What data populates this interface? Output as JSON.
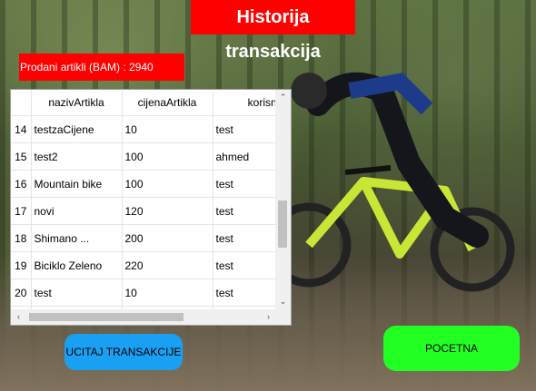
{
  "window": {
    "title": "Historija transakcija"
  },
  "summary": {
    "sold_label": "Prodani artikli (BAM) : 2940"
  },
  "table": {
    "columns": [
      "nazivArtikla",
      "cijenaArtikla",
      "korisnik"
    ],
    "rows": [
      {
        "num": "14",
        "naziv": "testzaCijene",
        "cijena": "10",
        "korisnik": "test"
      },
      {
        "num": "15",
        "naziv": "test2",
        "cijena": "100",
        "korisnik": "ahmed"
      },
      {
        "num": "16",
        "naziv": "Mountain bike",
        "cijena": "100",
        "korisnik": "test"
      },
      {
        "num": "17",
        "naziv": "novi",
        "cijena": "120",
        "korisnik": "test"
      },
      {
        "num": "18",
        "naziv": "Shimano ...",
        "cijena": "200",
        "korisnik": "test"
      },
      {
        "num": "19",
        "naziv": "Biciklo Zeleno",
        "cijena": "220",
        "korisnik": "test"
      },
      {
        "num": "20",
        "naziv": "test",
        "cijena": "10",
        "korisnik": "test"
      },
      {
        "num": "",
        "naziv": "",
        "cijena": "",
        "korisnik": ""
      }
    ],
    "scroll": {
      "up": "⌃",
      "down": "⌄",
      "left": "‹",
      "right": "›"
    }
  },
  "buttons": {
    "load": "UCITAJ TRANSAKCIJE",
    "home": "POCETNA"
  },
  "colors": {
    "title_bg": "#ff0000",
    "load_btn": "#1aa0f2",
    "home_btn": "#22ff22",
    "bike": "#c8e635"
  }
}
